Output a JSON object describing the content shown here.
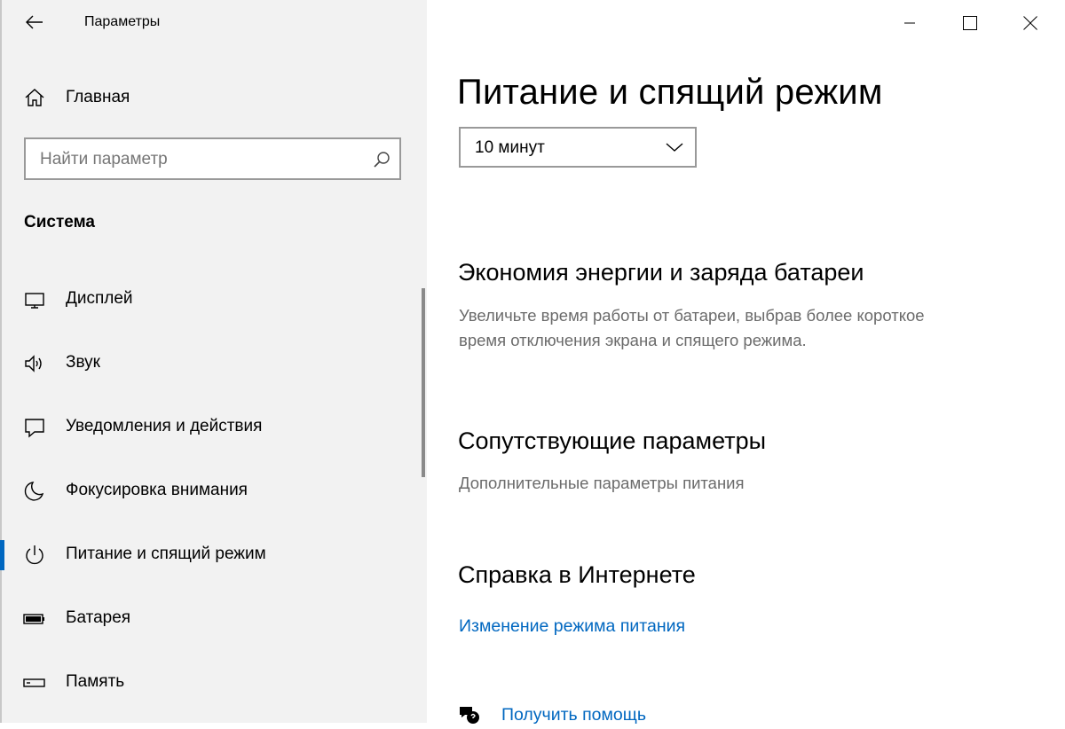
{
  "window": {
    "title": "Параметры",
    "minimize_icon": "minimize-icon",
    "maximize_icon": "maximize-icon",
    "close_icon": "close-icon"
  },
  "sidebar": {
    "home_label": "Главная",
    "search_placeholder": "Найти параметр",
    "section_title": "Система",
    "items": [
      {
        "label": "Дисплей",
        "icon": "display-icon"
      },
      {
        "label": "Звук",
        "icon": "speaker-icon"
      },
      {
        "label": "Уведомления и действия",
        "icon": "notification-icon"
      },
      {
        "label": "Фокусировка внимания",
        "icon": "moon-icon"
      },
      {
        "label": "Питание и спящий режим",
        "icon": "power-icon",
        "selected": true
      },
      {
        "label": "Батарея",
        "icon": "battery-icon"
      },
      {
        "label": "Память",
        "icon": "storage-icon"
      }
    ]
  },
  "main": {
    "title": "Питание и спящий режим",
    "sleep_dropdown_value": "10 минут",
    "energy": {
      "heading": "Экономия энергии и заряда батареи",
      "description_line1": "Увеличьте время работы от батареи, выбрав более короткое",
      "description_line2": "время отключения экрана и спящего режима."
    },
    "related": {
      "heading": "Сопутствующие параметры",
      "link": "Дополнительные параметры питания"
    },
    "help": {
      "heading": "Справка в Интернете",
      "link": "Изменение режима питания",
      "get_help": "Получить помощь"
    }
  },
  "colors": {
    "accent": "#0067c0",
    "sidebar_bg": "#f2f2f2",
    "secondary_text": "#6b6b6b"
  }
}
